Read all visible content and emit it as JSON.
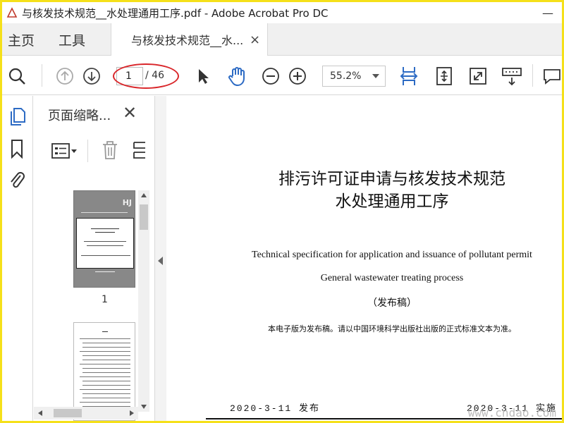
{
  "window": {
    "title": "与核发技术规范__水处理通用工序.pdf - Adobe Acrobat Pro DC",
    "minimize_label": "—"
  },
  "menu": {
    "home": "主页",
    "tools": "工具"
  },
  "tab": {
    "title": "与核发技术规范__水...",
    "close": "×"
  },
  "toolbar": {
    "current_page": "1",
    "total_pages": "/ 46",
    "zoom": "55.2%",
    "accent": "#2d6bc4",
    "highlight_color": "#d9262a"
  },
  "thumbnails_panel": {
    "title": "页面缩略...",
    "close": "✕",
    "page_labels": [
      "1"
    ],
    "thumb1_mark": "HJ"
  },
  "document": {
    "title_line1": "排污许可证申请与核发技术规范",
    "title_line2": "水处理通用工序",
    "en_line1": "Technical specification for application and issuance of pollutant permit",
    "en_line2": "General wastewater treating process",
    "status": "（发布稿）",
    "note": "本电子版为发布稿。请以中国环境科学出版社出版的正式标准文本为准。",
    "issue_date": "2020-3-11 发布",
    "effective_date": "2020-3-11 实施"
  },
  "watermark": "www.cndao.com"
}
